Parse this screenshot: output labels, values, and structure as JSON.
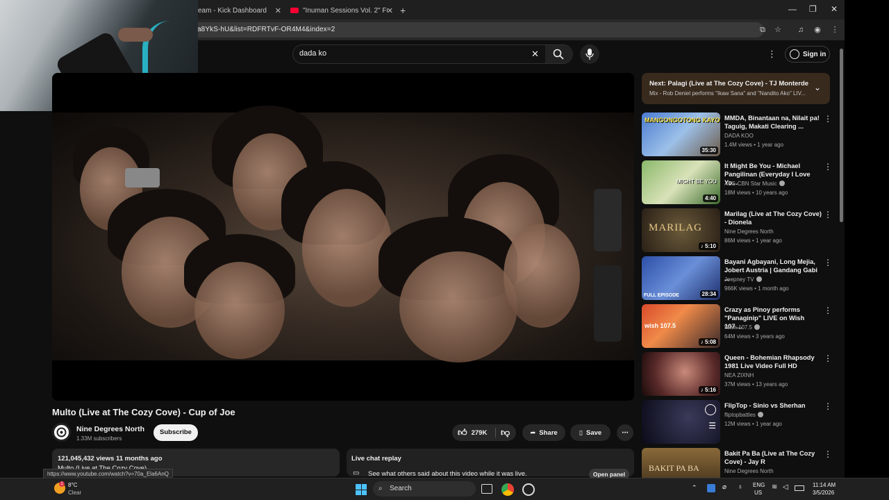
{
  "browser": {
    "tabs": [
      {
        "label": "eam - Kick Dashboard"
      },
      {
        "label": "\"Inuman Sessions Vol. 2\" Full C"
      }
    ],
    "new_tab": "+",
    "url": "a8YkS-hU&list=RDFRTvF-OR4M4&index=2",
    "status_url": "https://www.youtube.com/watch?v=70a_Ela6AnQ"
  },
  "header": {
    "search_value": "dada ko",
    "sign_in": "Sign in"
  },
  "video": {
    "title": "Multo (Live at The Cozy Cove) - Cup of Joe",
    "channel": "Nine Degrees North",
    "subscribers": "1.33M subscribers",
    "subscribe": "Subscribe",
    "likes": "279K",
    "share": "Share",
    "save": "Save",
    "views_date": "121,045,432 views  11 months ago",
    "desc_snippet": "Multo (Live at The Cozy Cove)"
  },
  "live_chat": {
    "title": "Live chat replay",
    "text": "See what others said about this video while it was live.",
    "open": "Open panel"
  },
  "next": {
    "title": "Next: Palagi (Live at The Cozy Cove) - TJ Monterde",
    "subtitle": "Mix - Rob Deniel performs \"Ikaw Sana\" and \"Nandito Ako\" LIV..."
  },
  "recommendations": [
    {
      "title": "MMDA, Binantaan na, Nilait pa! Taguig, Makati Clearing ...",
      "channel": "DADA KOO",
      "meta": "1.4M views • 1 year ago",
      "duration": "35:30",
      "verified": false,
      "thumb_text": "MANGONGOTONG KAYO!"
    },
    {
      "title": "It Might Be You - Michael Pangilinan (Everyday I Love Yo...",
      "channel": "ABS-CBN Star Music",
      "meta": "18M views • 10 years ago",
      "duration": "4:40",
      "verified": true,
      "thumb_text": "MIGHT BE YOU"
    },
    {
      "title": "Marilag (Live at The Cozy Cove) - Dionela",
      "channel": "Nine Degrees North",
      "meta": "86M views • 1 year ago",
      "duration": "5:10",
      "verified": false,
      "thumb_text": "MARILAG"
    },
    {
      "title": "Bayani Agbayani, Long Mejia, Jobert Austria | Gandang Gabi ...",
      "channel": "Jeepney TV",
      "meta": "966K views • 1 month ago",
      "duration": "28:34",
      "verified": true,
      "thumb_text": "FULL EPISODE"
    },
    {
      "title": "Crazy as Pinoy performs \"Panaginip\" LIVE on Wish 107....",
      "channel": "Wish 107.5",
      "meta": "64M views • 3 years ago",
      "duration": "5:08",
      "verified": true,
      "thumb_text": "wish 107.5"
    },
    {
      "title": "Queen - Bohemian Rhapsody 1981 Live Video Full HD",
      "channel": "NEA ZIXNH",
      "meta": "37M views • 13 years ago",
      "duration": "5:16",
      "verified": false,
      "thumb_text": ""
    },
    {
      "title": "FlipTop - Sinio vs Sherhan",
      "channel": "fliptopbattles",
      "meta": "12M views • 1 year ago",
      "duration": "",
      "verified": true,
      "thumb_text": ""
    },
    {
      "title": "Bakit Pa Ba (Live at The Cozy Cove) - Jay R",
      "channel": "Nine Degrees North",
      "meta": "",
      "duration": "",
      "verified": false,
      "thumb_text": "BAKIT PA BA"
    }
  ],
  "taskbar": {
    "weather_temp": "8°C",
    "weather_desc": "Clear",
    "search": "Search",
    "lang1": "ENG",
    "lang2": "US",
    "time": "11:14 AM",
    "date": "3/5/2026"
  },
  "colors": {
    "accent": "#ff0033",
    "next_bg": "#382a1d"
  }
}
